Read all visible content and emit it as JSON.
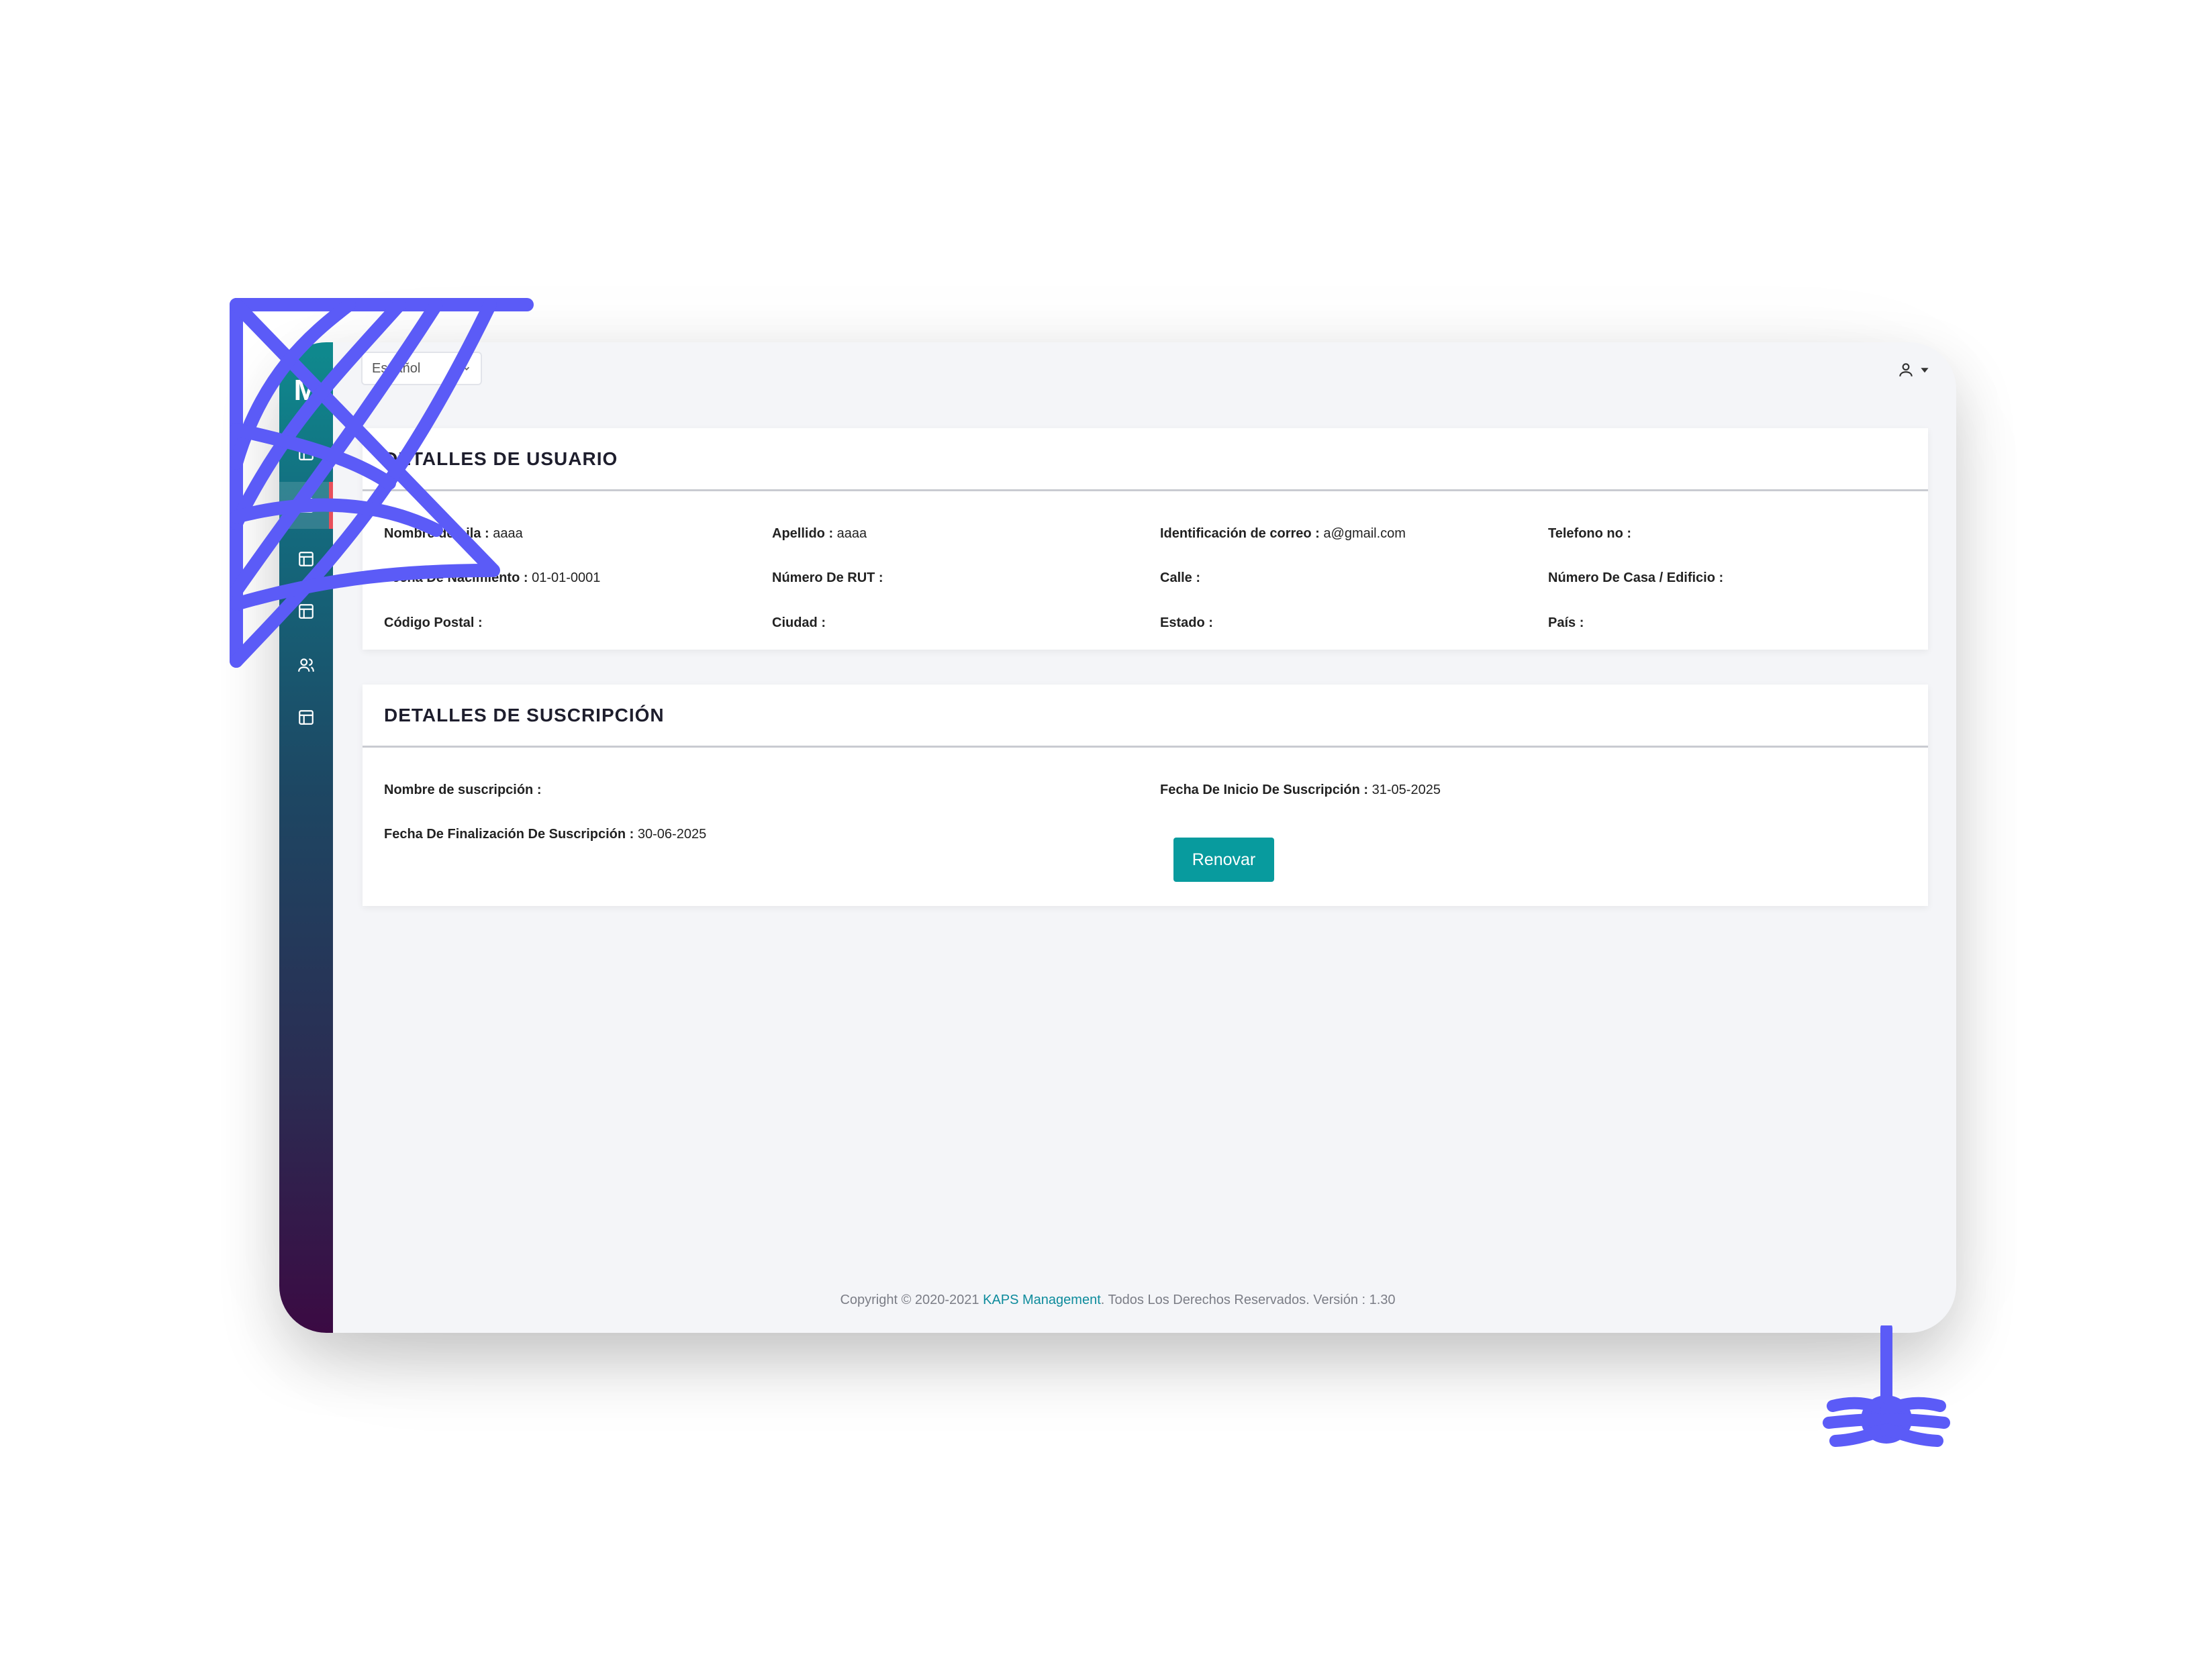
{
  "app": {
    "language": "Español",
    "logo_text": "M"
  },
  "user_details": {
    "title": "DETALLES DE USUARIO",
    "fields": [
      {
        "label": "Nombre de pila :",
        "value": "aaaa"
      },
      {
        "label": "Apellido :",
        "value": "aaaa"
      },
      {
        "label": "Identificación de correo :",
        "value": "a@gmail.com"
      },
      {
        "label": "Telefono no :",
        "value": ""
      },
      {
        "label": "Fecha De Nacimiento :",
        "value": "01-01-0001"
      },
      {
        "label": "Número De RUT :",
        "value": ""
      },
      {
        "label": "Calle :",
        "value": ""
      },
      {
        "label": "Número De Casa / Edificio :",
        "value": ""
      },
      {
        "label": "Código Postal :",
        "value": ""
      },
      {
        "label": "Ciudad :",
        "value": ""
      },
      {
        "label": "Estado :",
        "value": ""
      },
      {
        "label": "País :",
        "value": ""
      }
    ]
  },
  "subscription_details": {
    "title": "DETALLES DE SUSCRIPCIÓN",
    "fields": [
      {
        "label": "Nombre de suscripción :",
        "value": ""
      },
      {
        "label": "Fecha De Inicio De Suscripción :",
        "value": "31-05-2025"
      },
      {
        "label": "Fecha De Finalización De Suscripción :",
        "value": "30-06-2025"
      }
    ],
    "renew_label": "Renovar"
  },
  "footer": {
    "prefix": "Copyright © 2020-2021 ",
    "brand": "KAPS Management",
    "suffix": ". Todos Los Derechos Reservados. Versión : 1.30"
  },
  "colors": {
    "accent": "#089b9e",
    "brand_link": "#0d8b9c",
    "sidebar_top": "#0f8a8e",
    "sidebar_bottom": "#3b0a43",
    "decoration": "#5b5bf7"
  },
  "icons": {
    "sidebar": [
      "layout-icon",
      "form-icon",
      "layout-icon",
      "layout-icon",
      "users-icon",
      "layout-icon"
    ],
    "user": "user-icon",
    "decorations": [
      "spider-web-icon",
      "spider-icon"
    ]
  }
}
